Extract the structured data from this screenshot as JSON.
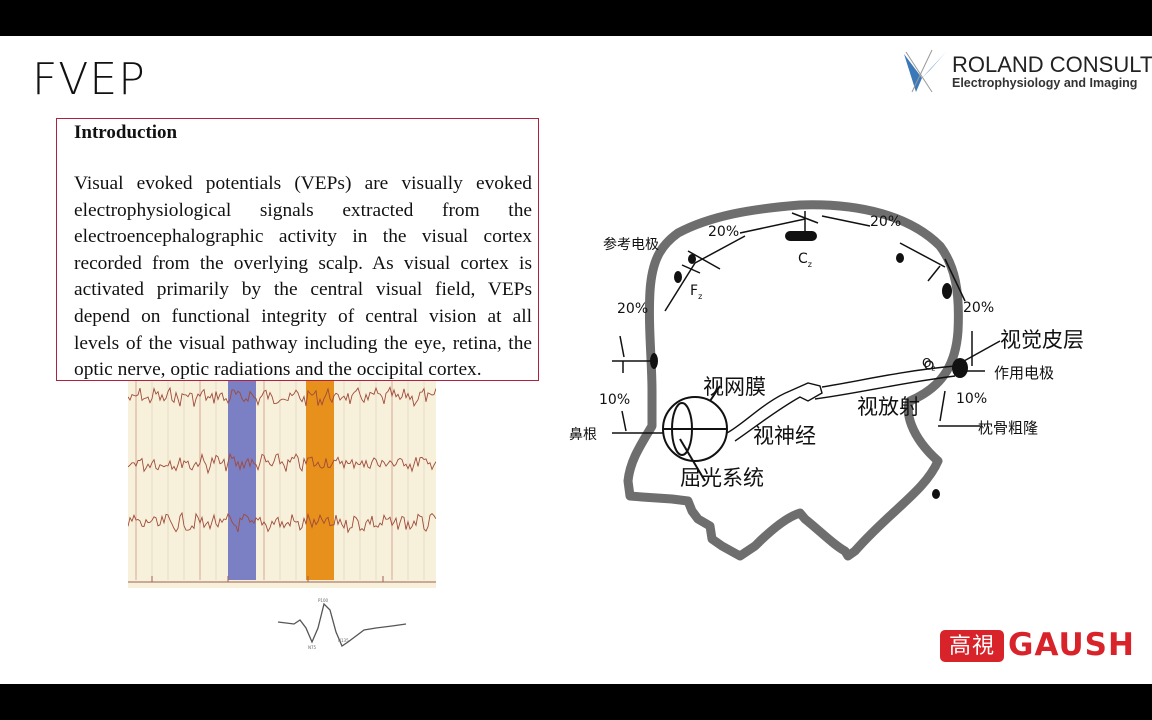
{
  "slide": {
    "title": "FVEP"
  },
  "logos": {
    "roland": {
      "name": "ROLAND CONSULT",
      "tagline": "Electrophysiology and Imaging",
      "color": "#3a78b8"
    },
    "gaush": {
      "badge": "高視",
      "name": "GAUSH",
      "color": "#d8232a"
    }
  },
  "intro": {
    "heading": "Introduction",
    "body": "Visual evoked potentials (VEPs) are visually evoked electrophysiological signals extracted from the electroencephalographic activity in the visual cortex recorded from the overlying scalp. As visual cortex is activated primarily by the central visual field, VEPs depend on functional integrity of central vision at all levels of the visual pathway including the eye, retina, the optic nerve, optic radiations and the occipital cortex.",
    "border_color": "#b02040"
  },
  "eeg_figure": {
    "trace_count": 3,
    "highlight_colors": [
      "#7b7fc4",
      "#e8901c"
    ],
    "trace_color": "#a04a3a"
  },
  "vep_waveform": {
    "peak_labels": [
      "N75",
      "P100",
      "N135"
    ]
  },
  "diagram": {
    "labels": {
      "reference_electrode": "参考电极",
      "active_electrode": "作用电极",
      "visual_cortex": "视觉皮层",
      "retina": "视网膜",
      "optic_nerve": "视神经",
      "optic_radiation": "视放射",
      "refractive_system": "屈光系统",
      "nasion": "鼻根",
      "inion": "枕骨粗隆",
      "fz": "F",
      "fz_sub": "z",
      "cz": "C",
      "cz_sub": "z",
      "oz": "O",
      "oz_sub": "z"
    },
    "percentages": {
      "front_upper": "20%",
      "front_top": "20%",
      "top_back": "20%",
      "back_upper": "20%",
      "front_lower": "10%",
      "back_lower": "10%"
    }
  }
}
